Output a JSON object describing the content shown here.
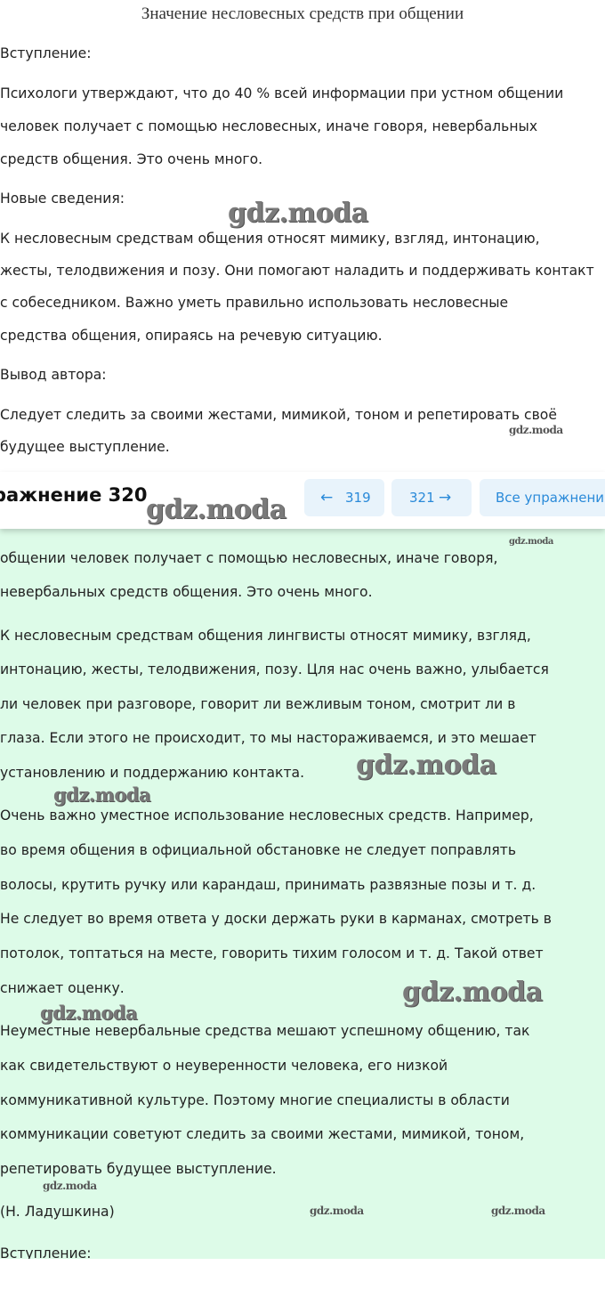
{
  "top": {
    "title": "Значение несловесных средств при общении",
    "intro_label": "Вступление:",
    "intro_lines": [
      "Психологи утверждают, что до 40 % всей информации при устном общении",
      "человек получает с помощью несловесных, иначе говоря, невербальных",
      "средств общения. Это очень много."
    ],
    "new_label": "Новые сведения:",
    "new_lines": [
      "К несловесным средствам общения относят мимику, взгляд, интонацию,",
      "жесты, телодвижения и позу. Они помогают наладить и поддерживать контакт",
      "с собеседником. Важно уметь правильно использовать несловесные",
      "средства общения, опираясь на речевую ситуацию."
    ],
    "conclusion_label": "Вывод автора:",
    "conclusion_lines": [
      "Следует следить за своими жестами, мимикой, тоном и репетировать своё",
      "будущее выступление."
    ]
  },
  "nav": {
    "exercise_title": "ражнение 320",
    "prev_label": "319",
    "next_label": "321",
    "all_label": "Все упражнения",
    "prev_icon": "arrow-left-icon",
    "next_icon": "arrow-right-icon",
    "accent_color": "#2a8ad9",
    "button_bg": "#e8f3fb"
  },
  "answer": {
    "bg_color": "#ddfbe8",
    "lines": [
      "общении человек получает с помощью несловесных, иначе говоря,",
      "невербальных средств общения. Это очень много.",
      "К несловесным средствам общения лингвисты относят мимику, взгляд,",
      "интонацию, жесты, телодвижения, позу. Цля нас очень важно, улыбается",
      "ли человек при разговоре, говорит ли вежливым тоном, смотрит ли в",
      "глаза. Если этого не происходит, то мы настораживаемся, и это мешает",
      "установлению и поддержанию контакта.",
      "Очень важно уместное использование несловесных средств. Например,",
      "во время общения в официальной обстановке не следует поправлять",
      "волосы, крутить ручку или карандаш, принимать развязные позы и т. д.",
      "Не следует во время ответа у доски держать руки в карманах, смотреть в",
      "потолок, топтаться на месте, говорить тихим голосом и т. д. Такой ответ",
      "снижает оценку.",
      "Неуместные невербальные средства мешают успешному общению, так",
      "как свидетельствуют о неуверенности человека, его низкой",
      "коммуникативной культуре. Поэтому многие специалисты в области",
      "коммуникации советуют следить за своими жестами, мимикой, тоном,",
      "репетировать будущее выступление.",
      "(Н. Ладушкина)",
      "Вступление:"
    ]
  },
  "watermark": "gdz.moda"
}
